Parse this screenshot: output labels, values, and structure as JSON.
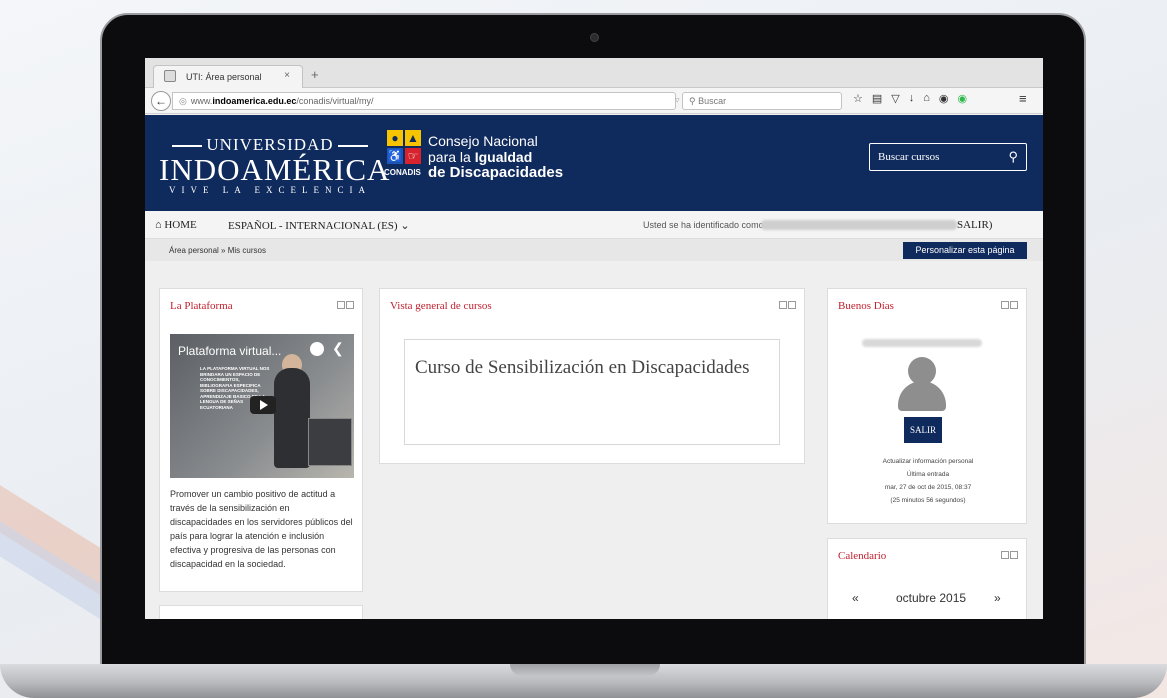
{
  "browser": {
    "tab_title": "UTI: Área personal",
    "tab_close": "×",
    "new_tab": "+",
    "url_prefix": "www.",
    "url_domain": "indoamerica.edu.ec",
    "url_path": "/conadis/virtual/my/",
    "search_placeholder": "Buscar"
  },
  "header": {
    "logo_top": "UNIVERSIDAD",
    "logo_main": "INDOAMÉRICA",
    "logo_sub": "VIVE LA EXCELENCIA",
    "conadis_label": "CONADIS",
    "conadis_line1": "Consejo Nacional",
    "conadis_line2_a": "para la ",
    "conadis_line2_b": "Igualdad",
    "conadis_line3": "de Discapacidades",
    "search_label": "Buscar cursos"
  },
  "menu": {
    "home": "HOME",
    "language": "ESPAÑOL - INTERNACIONAL (ES)",
    "identified_as": "Usted se ha identificado como",
    "logout": "SALIR)"
  },
  "breadcrumb": {
    "item1": "Área personal",
    "separator": "»",
    "item2": "Mis cursos",
    "personalize": "Personalizar esta página"
  },
  "platform_block": {
    "title": "La Plataforma",
    "video_title": "Plataforma virtual...",
    "video_text": "LA PLATAFORMA VIRTUAL NOS BRINDARA UN ESPACIO DE CONOCIMIENTOS, BIBLIOGRAFIA ESPECIFICA SOBRE DISCAPACIDADES, APRENDIZAJE BASICO DE LA LENGUA DE SEÑAS ECUATORIANA",
    "description": "Promover un cambio positivo de actitud a través de la sensibilización en discapacidades en los servidores públicos del país para lograr la atención e inclusión efectiva y progresiva de las personas con discapacidad en la sociedad."
  },
  "courses_block": {
    "title": "Vista general de cursos",
    "course_name": "Curso de Sensibilización en Discapacidades"
  },
  "user_block": {
    "title": "Buenos Días",
    "logout_button": "SALIR",
    "update_info": "Actualizar información personal",
    "last_login_label": "Última entrada",
    "last_login_date": "mar, 27 de oct de 2015, 08:37",
    "last_login_ago": "(25 minutos 56 segundos)"
  },
  "calendar_block": {
    "title": "Calendario",
    "prev": "«",
    "month": "octubre 2015",
    "next": "»"
  }
}
